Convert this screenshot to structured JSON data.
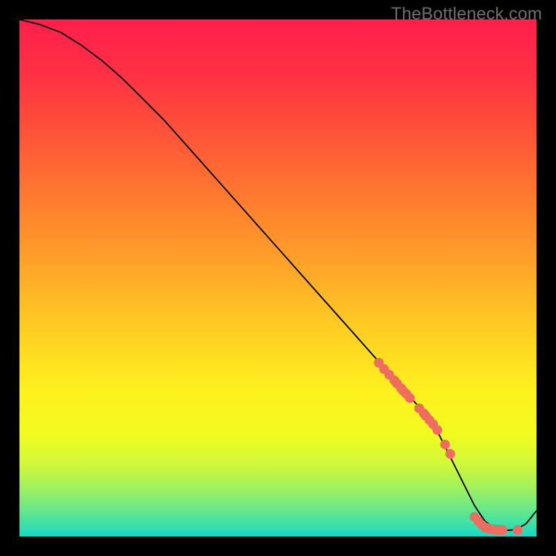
{
  "watermark": "TheBottleneck.com",
  "chart_data": {
    "type": "line",
    "title": "",
    "xlabel": "",
    "ylabel": "",
    "xlim": [
      0,
      100
    ],
    "ylim": [
      0,
      100
    ],
    "grid": false,
    "series": [
      {
        "name": "curve",
        "type": "line",
        "color": "#000000",
        "x": [
          0,
          4,
          8,
          12,
          16,
          20,
          24,
          28,
          32,
          36,
          40,
          44,
          48,
          52,
          56,
          60,
          64,
          68,
          72,
          76,
          80,
          82,
          84,
          86,
          88,
          90,
          92,
          94,
          96,
          98,
          100
        ],
        "y": [
          100,
          99,
          97.5,
          95,
          92,
          88.5,
          84.5,
          80.5,
          76,
          71.5,
          67,
          62.5,
          58,
          53.5,
          49,
          44.5,
          40,
          35.5,
          31,
          26.5,
          22,
          18,
          14,
          10,
          6,
          3,
          1.5,
          1.2,
          1.3,
          2.5,
          5
        ]
      },
      {
        "name": "highlight-points-upper",
        "type": "scatter",
        "color": "#ef6c60",
        "x": [
          69.5,
          70.5,
          71.5,
          72.5,
          73,
          73.8,
          74.2,
          74.8,
          75.5,
          77.3,
          78.2,
          78.6,
          79.3,
          80.0,
          80.8,
          82.3,
          83.3
        ],
        "y": [
          33.6,
          32.4,
          31.3,
          30.2,
          29.6,
          28.7,
          28.2,
          27.6,
          26.8,
          24.8,
          23.8,
          23.3,
          22.5,
          21.7,
          20.6,
          17.8,
          16.0
        ]
      },
      {
        "name": "highlight-points-valley",
        "type": "scatter",
        "color": "#ef6c60",
        "x": [
          88.0,
          88.8,
          89.5,
          90.0,
          90.3,
          90.6,
          91.0,
          91.6,
          92.3,
          92.8,
          93.4,
          96.3
        ],
        "y": [
          3.8,
          2.9,
          2.2,
          1.8,
          1.7,
          1.6,
          1.5,
          1.4,
          1.3,
          1.3,
          1.3,
          1.3
        ]
      }
    ],
    "background_gradient": {
      "stops": [
        {
          "offset": 0.0,
          "color": "#ff1f4b"
        },
        {
          "offset": 0.1,
          "color": "#ff2f44"
        },
        {
          "offset": 0.22,
          "color": "#ff5338"
        },
        {
          "offset": 0.35,
          "color": "#ff7c2f"
        },
        {
          "offset": 0.48,
          "color": "#ffa528"
        },
        {
          "offset": 0.6,
          "color": "#ffce22"
        },
        {
          "offset": 0.72,
          "color": "#fdf11e"
        },
        {
          "offset": 0.8,
          "color": "#f2fb1f"
        },
        {
          "offset": 0.86,
          "color": "#d0f93a"
        },
        {
          "offset": 0.9,
          "color": "#a6f25a"
        },
        {
          "offset": 0.93,
          "color": "#7fec78"
        },
        {
          "offset": 0.96,
          "color": "#55e596"
        },
        {
          "offset": 0.985,
          "color": "#2edeb2"
        },
        {
          "offset": 1.0,
          "color": "#13d8c7"
        }
      ]
    }
  }
}
